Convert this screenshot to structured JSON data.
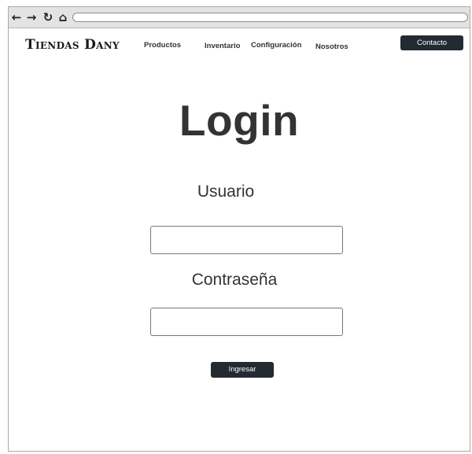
{
  "browser": {
    "back_icon": "arrow-left-icon",
    "back_glyph": "←",
    "forward_icon": "arrow-right-icon",
    "forward_glyph": "→",
    "reload_icon": "reload-icon",
    "reload_glyph": "↻",
    "home_icon": "home-icon",
    "home_glyph": "⌂",
    "address": ""
  },
  "header": {
    "brand": "Tiendas Dany",
    "nav": {
      "productos": "Productos",
      "inventario": "Inventario",
      "configuracion": "Configuración",
      "nosotros": "Nosotros"
    },
    "contact_label": "Contacto"
  },
  "login": {
    "title": "Login",
    "username_label": "Usuario",
    "username_value": "",
    "password_label": "Contraseña",
    "password_value": "",
    "submit_label": "Ingresar"
  },
  "colors": {
    "button_bg": "#232a32",
    "text_dark": "#333333",
    "chrome_bar": "#e3e3e3"
  }
}
